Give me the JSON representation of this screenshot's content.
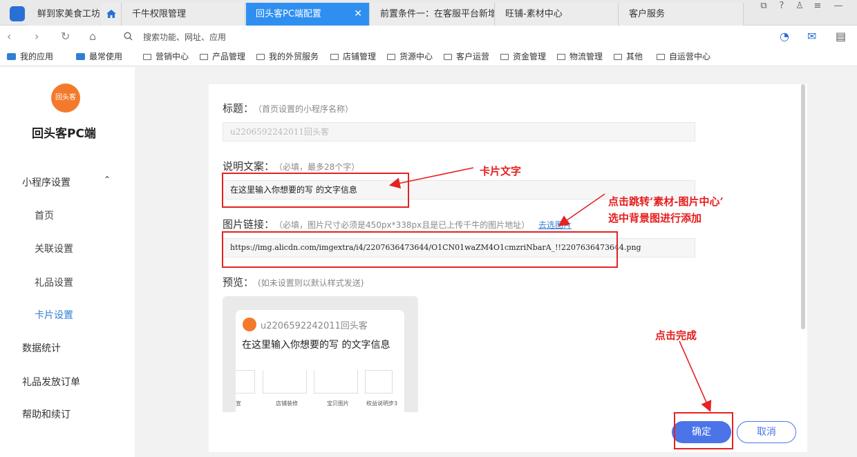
{
  "tabs": [
    {
      "label": "鲜到家美食工坊"
    },
    {
      "label": "千牛权限管理"
    },
    {
      "label": "回头客PC端配置",
      "active": true
    },
    {
      "label": "前置条件一：在客服平台新增"
    },
    {
      "label": "旺铺-素材中心"
    },
    {
      "label": "客户服务"
    }
  ],
  "tab_close": "✕",
  "address": {
    "placeholder": "搜索功能、网址、应用"
  },
  "bookmarks": [
    "我的应用",
    "最常使用",
    "营销中心",
    "产品管理",
    "我的外贸服务",
    "店铺管理",
    "货源中心",
    "客户运营",
    "资金管理",
    "物流管理",
    "其他",
    "自运营中心"
  ],
  "sidebar": {
    "logo_text": "回头客",
    "app_title": "回头客PC端",
    "group": "小程序设置",
    "items": [
      "首页",
      "关联设置",
      "礼品设置",
      "卡片设置"
    ],
    "active_item": "卡片设置",
    "others": [
      "数据统计",
      "礼品发放订单",
      "帮助和续订"
    ]
  },
  "form": {
    "title_label": "标题：",
    "title_hint": "（首页设置的小程序名称）",
    "title_value": "u2206592242011回头客",
    "desc_label": "说明文案：",
    "desc_hint": "（必填，最多28个字）",
    "desc_value": "在这里输入你想要的写 的文字信息",
    "img_label": "图片链接：",
    "img_hint": "（必填，图片尺寸必须是450px*338px且是已上传千牛的图片地址）",
    "img_link": "去选图片",
    "img_value": "https://img.alicdn.com/imgextra/i4/2207636473644/O1CN01waZM4O1cmzriNbarA_!!2207636473644.png",
    "preview_label": "预览：",
    "preview_hint": "(如未设置则以默认样式发送)"
  },
  "preview": {
    "shop": "u2206592242011回头客",
    "text": "在这里输入你想要的写 的文字信息",
    "thumbs": [
      "店铺装修",
      "宝贝图片",
      "权益说明步3"
    ],
    "thumb_first": "宣"
  },
  "buttons": {
    "ok": "确定",
    "cancel": "取消"
  },
  "annotations": {
    "card_text": "卡片文字",
    "material_line1": "点击跳转‘素材-图片中心’",
    "material_line2": "选中背景图进行添加",
    "finish": "点击完成"
  },
  "colors": {
    "accent": "#2f8ff0",
    "annotation": "#e52121",
    "ok_button": "#4a74e8"
  }
}
